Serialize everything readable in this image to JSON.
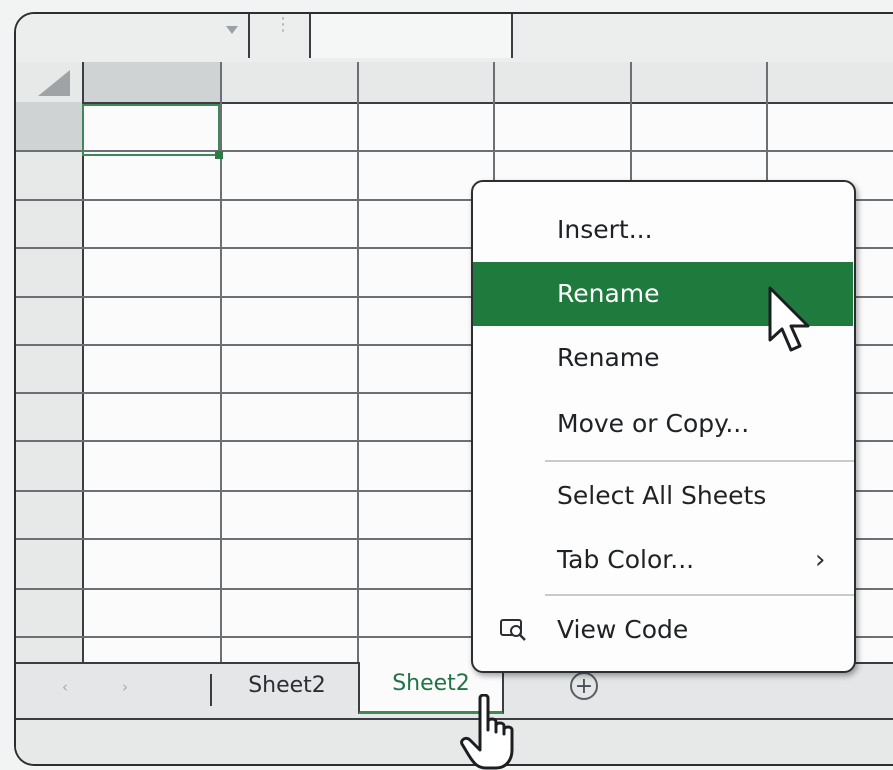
{
  "sheet_tabs": [
    "Sheet2",
    "Sheet2"
  ],
  "active_tab_index": 1,
  "add_sheet_glyph": "+",
  "tab_nav": [
    "‹",
    "›"
  ],
  "context_menu": {
    "items": [
      {
        "label": "Insert...",
        "highlighted": false
      },
      {
        "label": "Rename",
        "highlighted": true
      },
      {
        "label": "Rename",
        "highlighted": false
      },
      {
        "label": "Move or Copy...",
        "highlighted": false
      },
      {
        "label": "Select All Sheets",
        "highlighted": false
      },
      {
        "label": "Tab Color...",
        "highlighted": false,
        "submenu_glyph": "›"
      },
      {
        "label": "View Code",
        "highlighted": false,
        "icon": "view-code-icon"
      }
    ]
  },
  "colors": {
    "accent": "#1f7a3d",
    "active_tab_text": "#217346",
    "cell_selection": "#3d8a56"
  },
  "icons": [
    "dropdown-arrow-icon",
    "select-all-corner-icon",
    "add-sheet-icon",
    "view-code-icon",
    "arrow-cursor-icon",
    "hand-cursor-icon"
  ]
}
